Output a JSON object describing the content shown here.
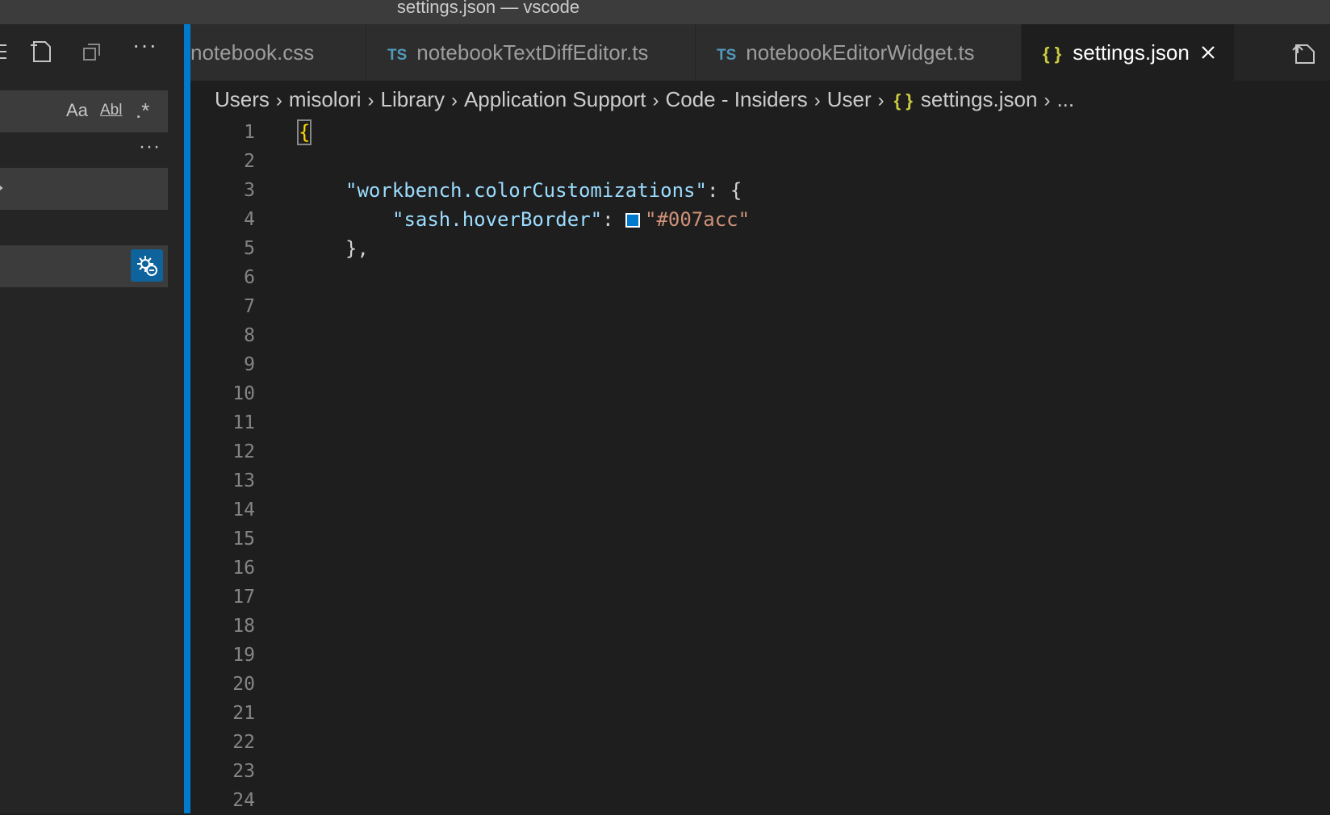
{
  "window": {
    "title": "settings.json — vscode"
  },
  "tabs": [
    {
      "label": "notebook.css",
      "badge": ""
    },
    {
      "label": "notebookTextDiffEditor.ts",
      "badge": "TS"
    },
    {
      "label": "notebookEditorWidget.ts",
      "badge": "TS"
    },
    {
      "label": "settings.json",
      "badge": "{ }"
    }
  ],
  "breadcrumb": [
    "Users",
    "misolori",
    "Library",
    "Application Support",
    "Code - Insiders",
    "User",
    "settings.json",
    "..."
  ],
  "breadcrumb_file_badge": "{ }",
  "search": {
    "match_case": "Aa",
    "whole_word": "Abl",
    "regex": ".*",
    "more": "···"
  },
  "editor": {
    "line_numbers": [
      "1",
      "2",
      "3",
      "4",
      "5",
      "6",
      "7",
      "8",
      "9",
      "10",
      "11",
      "12",
      "13",
      "14",
      "15",
      "16",
      "17",
      "18",
      "19",
      "20",
      "21",
      "22",
      "23",
      "24"
    ],
    "line1": "{",
    "line3_key": "\"workbench.colorCustomizations\"",
    "line3_rest": ": {",
    "line4_key": "\"sash.hoverBorder\"",
    "line4_colon": ": ",
    "line4_value": "\"#007acc\"",
    "line5": "},"
  },
  "colors": {
    "accent": "#007acc",
    "swatch": "#007acc"
  }
}
